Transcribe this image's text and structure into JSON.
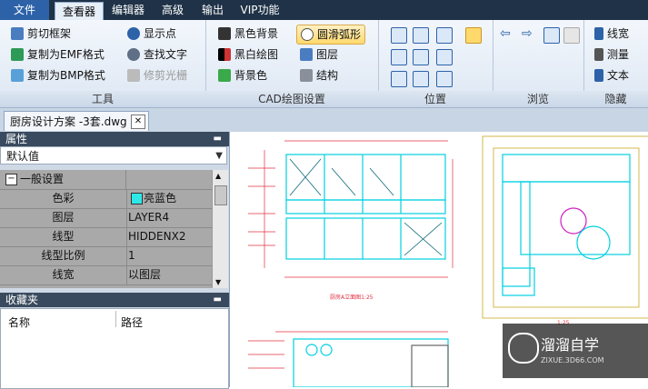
{
  "menu": {
    "file": "文件",
    "viewer": "查看器",
    "editor": "编辑器",
    "advanced": "高级",
    "output": "输出",
    "vip": "VIP功能"
  },
  "tools": {
    "crop": "剪切框架",
    "copy_emf": "复制为EMF格式",
    "copy_bmp": "复制为BMP格式",
    "show_points": "显示点",
    "find_text": "查找文字",
    "trim_raster": "修剪光栅",
    "label": "工具"
  },
  "cad": {
    "black_bg": "黑色背景",
    "bw_draw": "黑白绘图",
    "bg_color": "背景色",
    "smooth_arc": "圆滑弧形",
    "layers": "图层",
    "structure": "结构",
    "label": "CAD绘图设置"
  },
  "position": {
    "label": "位置"
  },
  "browse": {
    "label": "浏览"
  },
  "hide": {
    "lineweight": "线宽",
    "measure": "测量",
    "text": "文本",
    "label": "隐藏"
  },
  "document_tab": "厨房设计方案 -3套.dwg",
  "properties": {
    "title": "属性",
    "preset": "默认值",
    "rows": [
      {
        "key": "一般设置",
        "value": ""
      },
      {
        "key": "色彩",
        "value": "亮蓝色"
      },
      {
        "key": "图层",
        "value": "LAYER4"
      },
      {
        "key": "线型",
        "value": "HIDDENX2"
      },
      {
        "key": "线型比例",
        "value": "1"
      },
      {
        "key": "线宽",
        "value": "以图层"
      }
    ]
  },
  "favorites": {
    "title": "收藏夹",
    "col_name": "名称",
    "col_path": "路径"
  },
  "drawing_labels": {
    "elev_a": "厨房A立面图1:25",
    "elev_b": "1:25"
  },
  "watermark": {
    "brand": "溜溜自学",
    "url": "ZIXUE.3D66.COM"
  }
}
